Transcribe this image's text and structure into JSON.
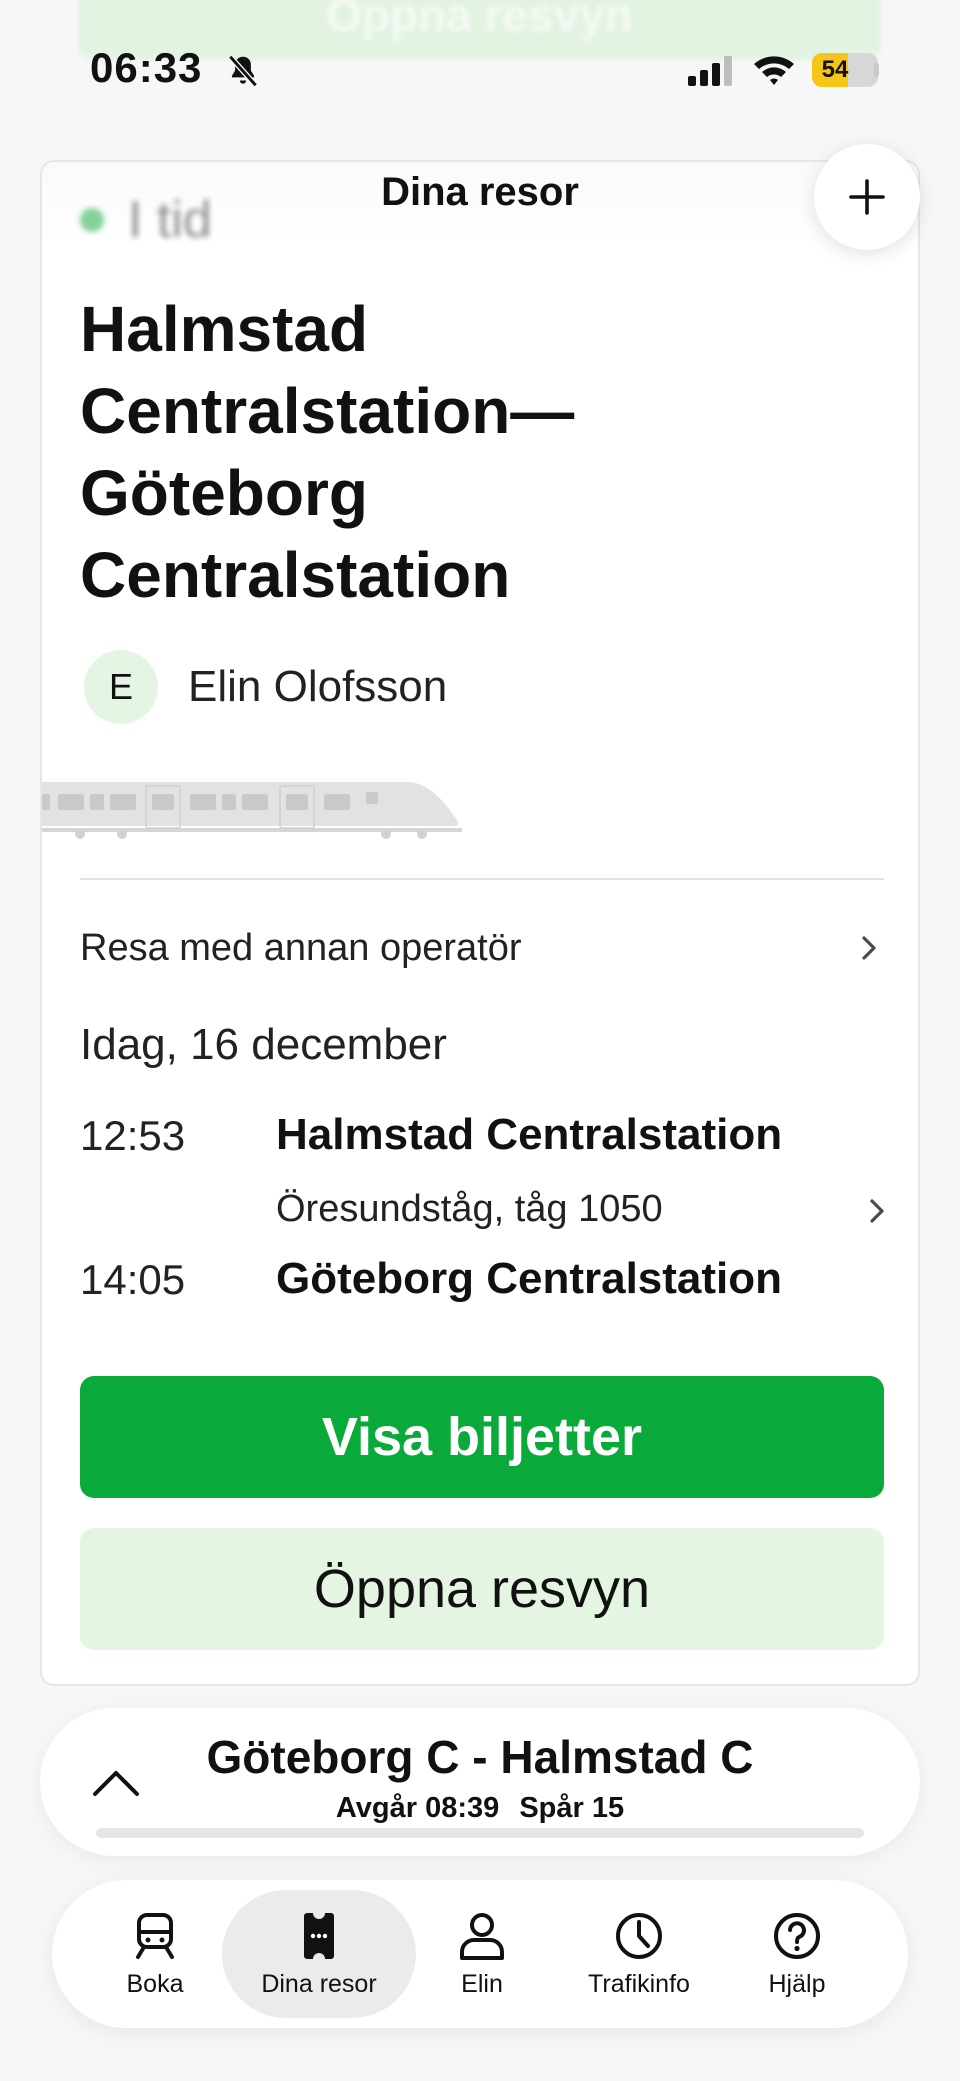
{
  "status_bar": {
    "time": "06:33",
    "battery": "54",
    "battery_level": 0.54,
    "battery_color": "#f5c518"
  },
  "ghost_button_label": "Öppna resvyn",
  "header": {
    "title": "Dina resor",
    "add_icon": "plus-icon"
  },
  "trip": {
    "status": "I tid",
    "status_color": "#1fae48",
    "title": "Halmstad Centralstation— Göteborg Centralstation",
    "passenger_initial": "E",
    "passenger_name": "Elin Olofsson",
    "operator_label": "Resa med annan operatör",
    "date": "Idag, 16 december",
    "departure_time": "12:53",
    "departure_station": "Halmstad Centralstation",
    "service": "Öresundståg, tåg 1050",
    "arrival_time": "14:05",
    "arrival_station": "Göteborg Centralstation",
    "primary_button": "Visa biljetter",
    "primary_color": "#0aaa3a",
    "secondary_button": "Öppna resvyn"
  },
  "mini_player": {
    "title": "Göteborg C - Halmstad C",
    "departs_label": "Avgår 08:39",
    "track_label": "Spår  15"
  },
  "tabs": [
    {
      "label": "Boka",
      "icon": "train-icon",
      "active": false
    },
    {
      "label": "Dina resor",
      "icon": "ticket-icon",
      "active": true
    },
    {
      "label": "Elin",
      "icon": "person-icon",
      "active": false
    },
    {
      "label": "Trafikinfo",
      "icon": "clock-icon",
      "active": false
    },
    {
      "label": "Hjälp",
      "icon": "help-icon",
      "active": false
    }
  ]
}
